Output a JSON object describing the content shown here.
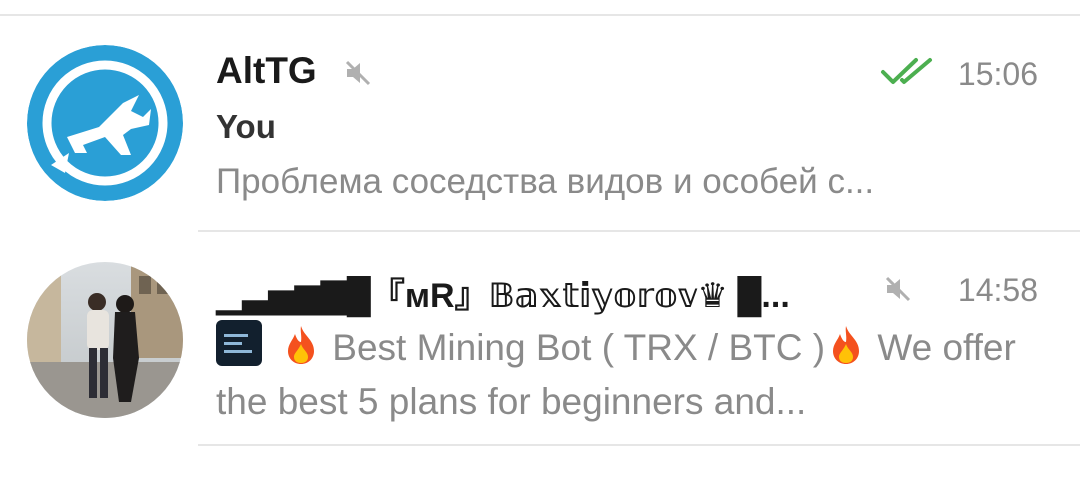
{
  "chats": [
    {
      "title": "AltTG",
      "muted": true,
      "read_status": "double-check",
      "time": "15:06",
      "sender": "You",
      "preview": "Проблема соседства видов и особей с...",
      "avatar_icon": "airplane-icon",
      "avatar_color": "#2a9fd6"
    },
    {
      "title": "▁▃▅▆▇█『мR』𝔹𝕒𝕩𝕥𝕚𝕪𝕠𝕣𝕠𝕧♛ █...",
      "muted": true,
      "time": "14:58",
      "preview_part1": "Best Mining Bot ( TRX / BTC )",
      "preview_part2": "We offer the best 5 plans for beginners and...",
      "preview_icons": [
        "image-thumbnail-icon",
        "fire-emoji-icon",
        "fire-emoji-icon"
      ],
      "avatar_icon": "photo-avatar"
    }
  ],
  "colors": {
    "read_check": "#4caf50",
    "secondary_text": "#8a8a8a",
    "divider": "#e6e6e6"
  }
}
